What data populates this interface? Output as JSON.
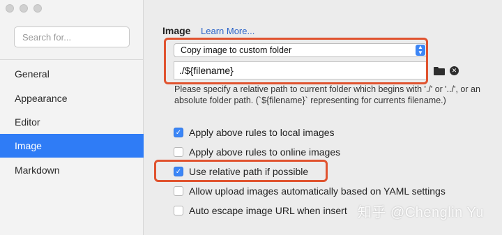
{
  "window": {
    "traffic_lights": [
      "close",
      "minimize",
      "zoom"
    ]
  },
  "sidebar": {
    "search_placeholder": "Search for...",
    "items": [
      {
        "label": "General",
        "active": false
      },
      {
        "label": "Appearance",
        "active": false
      },
      {
        "label": "Editor",
        "active": false
      },
      {
        "label": "Image",
        "active": true
      },
      {
        "label": "Markdown",
        "active": false
      }
    ]
  },
  "main": {
    "section_title": "Image",
    "learn_more": "Learn More...",
    "select_value": "Copy image to custom folder",
    "path_value": "./${filename}",
    "hint": "Please specify a relative path to current folder which begins with './' or '../', or an absolute folder path. (`${filename}` representing for currents filename.)",
    "options": [
      {
        "label": "Apply above rules to local images",
        "checked": true
      },
      {
        "label": "Apply above rules to online images",
        "checked": false
      },
      {
        "label": "Use relative path if possible",
        "checked": true
      },
      {
        "label": "Allow upload images automatically based on YAML settings",
        "checked": false
      },
      {
        "label": "Auto escape image URL when insert",
        "checked": false
      }
    ]
  },
  "watermark": "知乎 @Chenglin Yu",
  "colors": {
    "accent": "#2f7cf6",
    "highlight": "#e0532f",
    "link": "#2b63c7"
  }
}
